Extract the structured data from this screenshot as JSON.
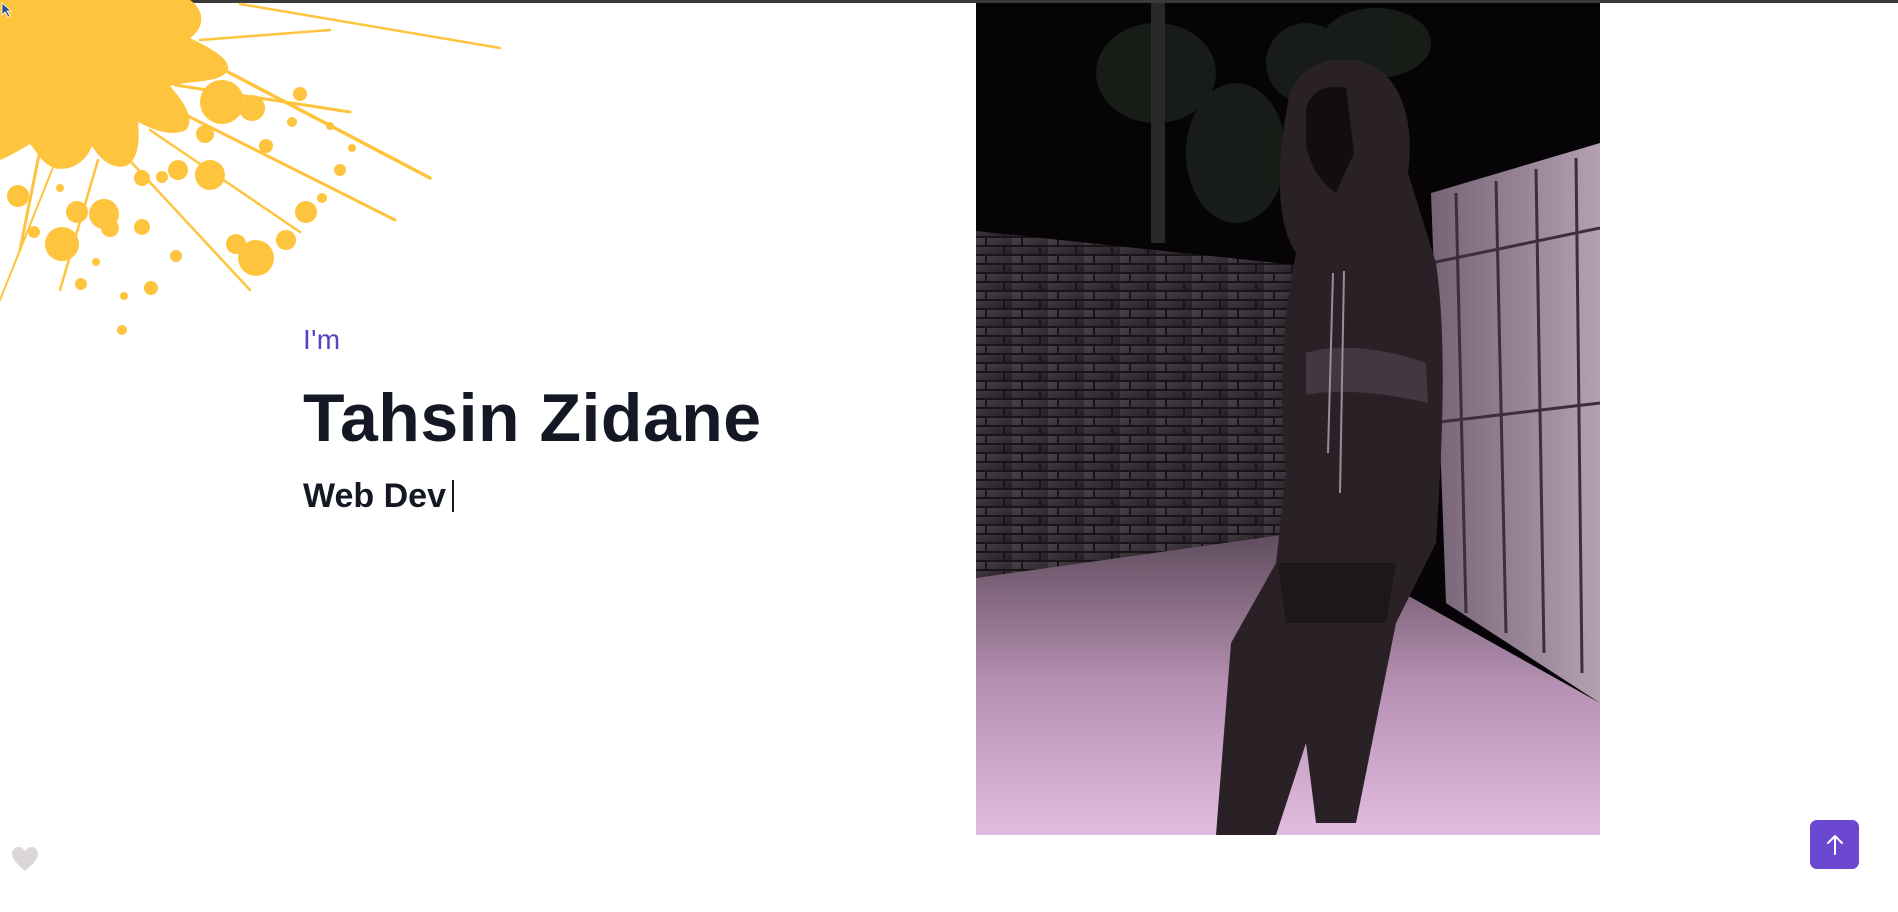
{
  "hero": {
    "greeting": "I'm",
    "name": "Tahsin Zidane",
    "role": "Web Dev"
  },
  "colors": {
    "accent": "#6c47cf",
    "greeting": "#5b3fc4",
    "heading": "#141824",
    "splash": "#ffc43d",
    "heart": "#ddd6d6"
  },
  "icons": {
    "scroll_top": "arrow-up-icon",
    "favorite": "heart-icon",
    "decoration": "paint-splash"
  }
}
